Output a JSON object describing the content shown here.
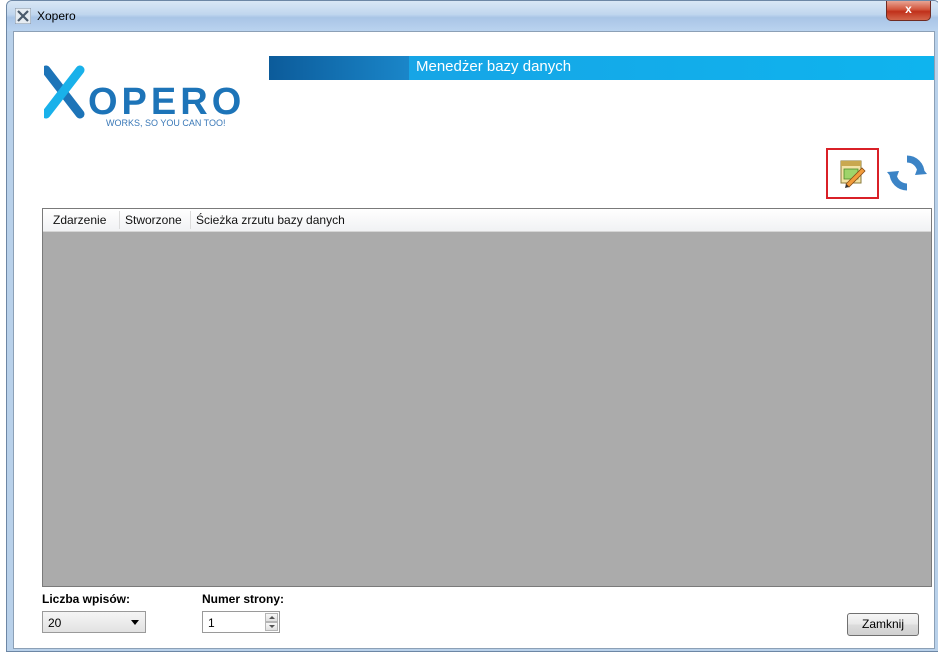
{
  "window": {
    "title": "Xopero",
    "close_glyph": "x",
    "app_icon": "xopero-x-icon"
  },
  "logo": {
    "wordmark": "XOPERO",
    "tagline": "WORKS, SO YOU CAN TOO!"
  },
  "header": {
    "title": "Menedżer bazy danych"
  },
  "toolbar": {
    "edit_icon": "edit-settings-icon",
    "refresh_icon": "refresh-icon"
  },
  "table": {
    "columns": [
      "Zdarzenie",
      "Stworzone",
      "Ścieżka zrzutu bazy danych"
    ],
    "rows": []
  },
  "footer": {
    "entries_label": "Liczba wpisów:",
    "entries_value": "20",
    "page_label": "Numer strony:",
    "page_value": "1",
    "close_label": "Zamknij"
  },
  "colors": {
    "accent": "#16a5e6",
    "accent_dark": "#0c5b9a",
    "grid_bg": "#ababab",
    "highlight": "#d92027"
  }
}
